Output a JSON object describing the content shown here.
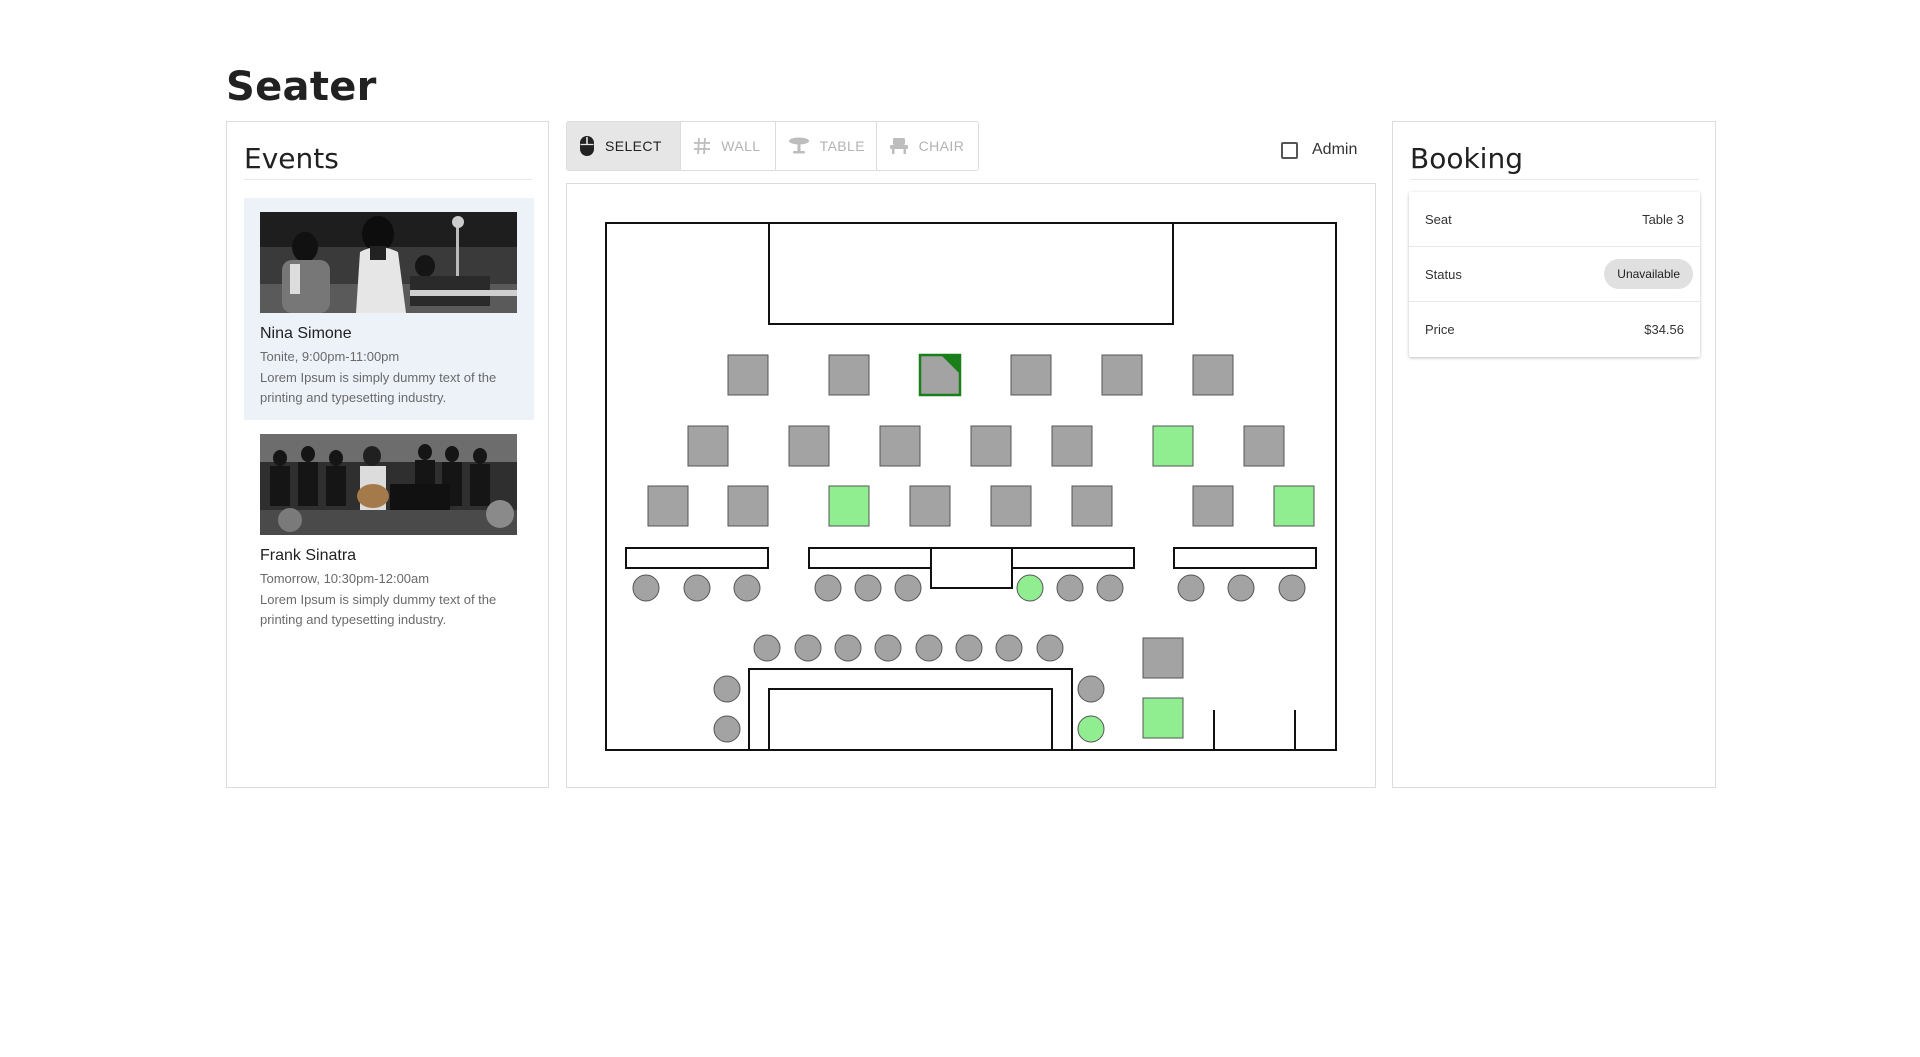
{
  "app": {
    "title": "Seater"
  },
  "events": {
    "title": "Events",
    "items": [
      {
        "name": "Nina Simone",
        "time": "Tonite, 9:00pm-11:00pm",
        "description": "Lorem Ipsum is simply dummy text of the printing and typesetting industry."
      },
      {
        "name": "Frank Sinatra",
        "time": "Tomorrow, 10:30pm-12:00am",
        "description": "Lorem Ipsum is simply dummy text of the printing and typesetting industry."
      }
    ]
  },
  "toolbar": {
    "tools": [
      {
        "label": "SELECT",
        "icon": "mouse-icon",
        "active": true
      },
      {
        "label": "WALL",
        "icon": "hash-icon",
        "active": false
      },
      {
        "label": "TABLE",
        "icon": "table-icon",
        "active": false
      },
      {
        "label": "CHAIR",
        "icon": "chair-icon",
        "active": false
      }
    ],
    "admin_label": "Admin"
  },
  "booking": {
    "title": "Booking",
    "rows": [
      {
        "label": "Seat",
        "value": "Table 3"
      },
      {
        "label": "Status",
        "value": "Unavailable"
      },
      {
        "label": "Price",
        "value": "$34.56"
      }
    ]
  },
  "colors": {
    "seat_taken": "#a3a3a3",
    "seat_available": "#90ee90",
    "seat_selected_border": "#1a7f1a",
    "selected_event_bg": "#edf1f8"
  }
}
